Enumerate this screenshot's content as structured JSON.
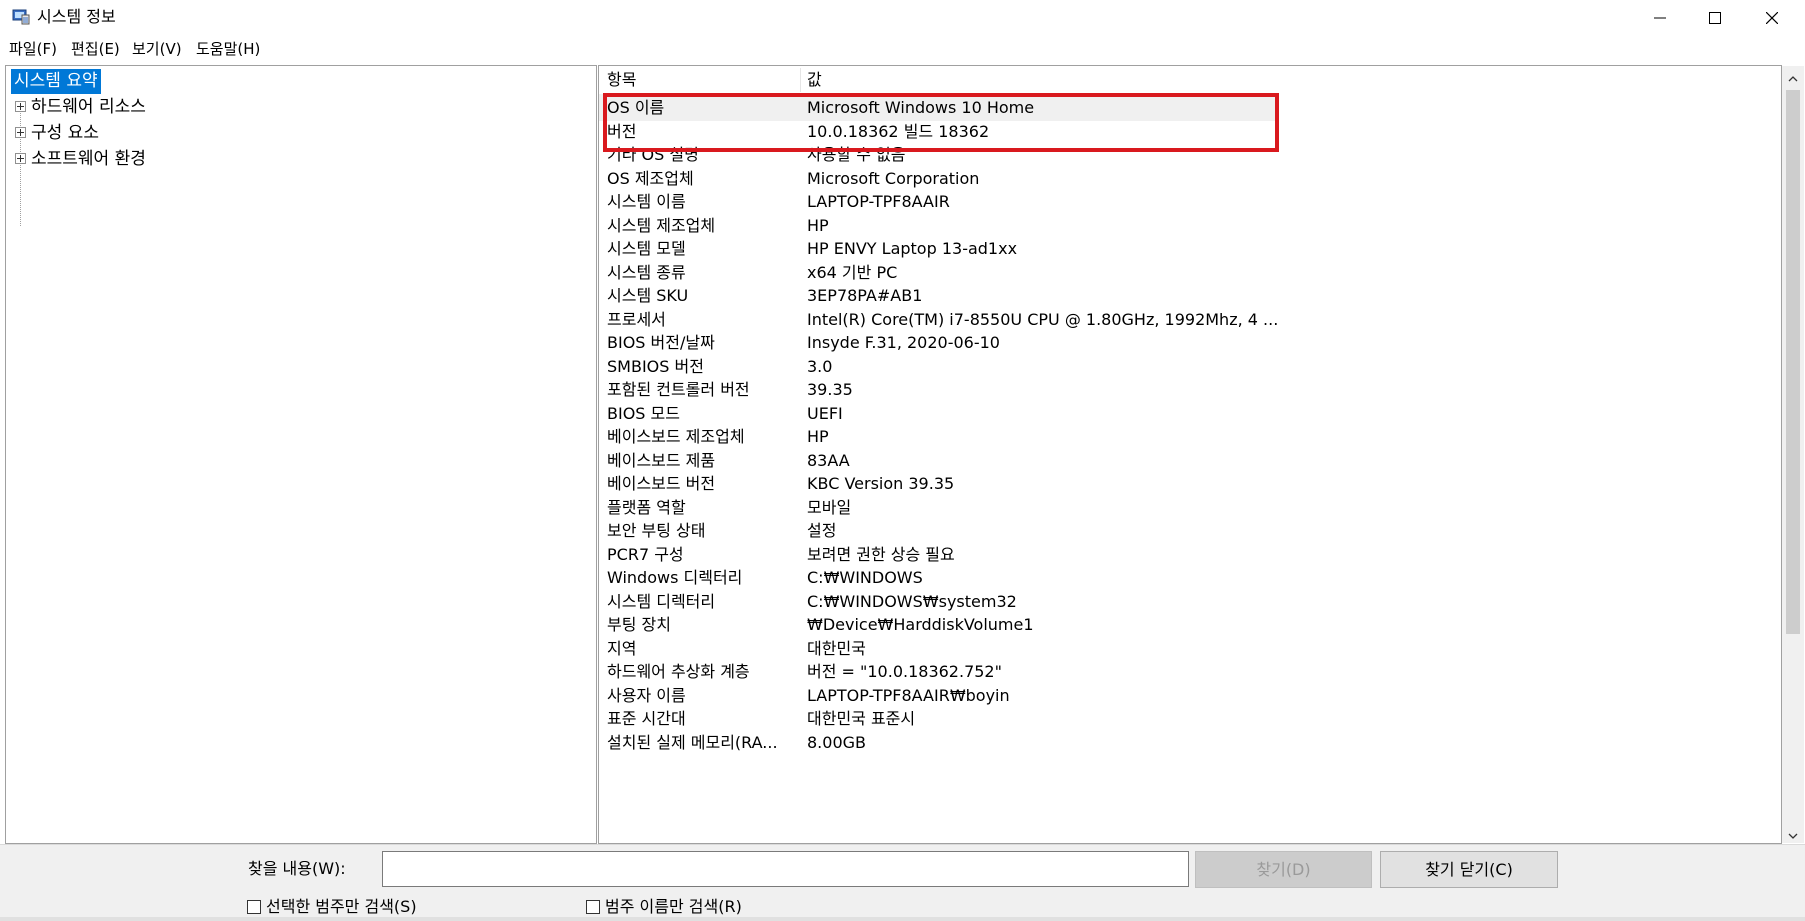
{
  "window": {
    "title": "시스템 정보",
    "icon": "system-info-icon",
    "controls": [
      "minimize-icon",
      "maximize-icon",
      "close-icon"
    ]
  },
  "menu": {
    "items": [
      "파일(F)",
      "편집(E)",
      "보기(V)",
      "도움말(H)"
    ]
  },
  "tree": {
    "root": "시스템 요약",
    "children": [
      "하드웨어 리소스",
      "구성 요소",
      "소프트웨어 환경"
    ]
  },
  "details": {
    "header_item": "항목",
    "header_value": "값",
    "rows": [
      {
        "item": "OS 이름",
        "value": "Microsoft Windows 10 Home"
      },
      {
        "item": "버전",
        "value": "10.0.18362 빌드 18362"
      },
      {
        "item": "기타 OS 설명",
        "value": "사용할 수 없음"
      },
      {
        "item": "OS 제조업체",
        "value": "Microsoft Corporation"
      },
      {
        "item": "시스템 이름",
        "value": "LAPTOP-TPF8AAIR"
      },
      {
        "item": "시스템 제조업체",
        "value": "HP"
      },
      {
        "item": "시스템 모델",
        "value": "HP ENVY Laptop 13-ad1xx"
      },
      {
        "item": "시스템 종류",
        "value": "x64 기반 PC"
      },
      {
        "item": "시스템 SKU",
        "value": "3EP78PA#AB1"
      },
      {
        "item": "프로세서",
        "value": "Intel(R) Core(TM) i7-8550U CPU @ 1.80GHz, 1992Mhz, 4 ..."
      },
      {
        "item": "BIOS 버전/날짜",
        "value": "Insyde F.31, 2020-06-10"
      },
      {
        "item": "SMBIOS 버전",
        "value": "3.0"
      },
      {
        "item": "포함된 컨트롤러 버전",
        "value": "39.35"
      },
      {
        "item": "BIOS 모드",
        "value": "UEFI"
      },
      {
        "item": "베이스보드 제조업체",
        "value": "HP"
      },
      {
        "item": "베이스보드 제품",
        "value": "83AA"
      },
      {
        "item": "베이스보드 버전",
        "value": "KBC Version 39.35"
      },
      {
        "item": "플랫폼 역할",
        "value": "모바일"
      },
      {
        "item": "보안 부팅 상태",
        "value": "설정"
      },
      {
        "item": "PCR7 구성",
        "value": "보려면 권한 상승 필요"
      },
      {
        "item": "Windows 디렉터리",
        "value": "C:₩WINDOWS"
      },
      {
        "item": "시스템 디렉터리",
        "value": "C:₩WINDOWS₩system32"
      },
      {
        "item": "부팅 장치",
        "value": "₩Device₩HarddiskVolume1"
      },
      {
        "item": "지역",
        "value": "대한민국"
      },
      {
        "item": "하드웨어 추상화 계층",
        "value": "버전 = \"10.0.18362.752\""
      },
      {
        "item": "사용자 이름",
        "value": "LAPTOP-TPF8AAIR₩boyin"
      },
      {
        "item": "표준 시간대",
        "value": "대한민국 표준시"
      },
      {
        "item": "설치된 실제 메모리(RA...",
        "value": "8.00GB"
      }
    ],
    "highlight_color": "#d9191e",
    "selection_color": "#0078d7"
  },
  "search": {
    "label": "찾을 내용(W):",
    "input_value": "",
    "find_button": "찾기(D)",
    "close_find_button": "찾기 닫기(C)",
    "check_selected_category": "선택한 범주만 검색(S)",
    "check_category_names": "범주 이름만 검색(R)"
  }
}
